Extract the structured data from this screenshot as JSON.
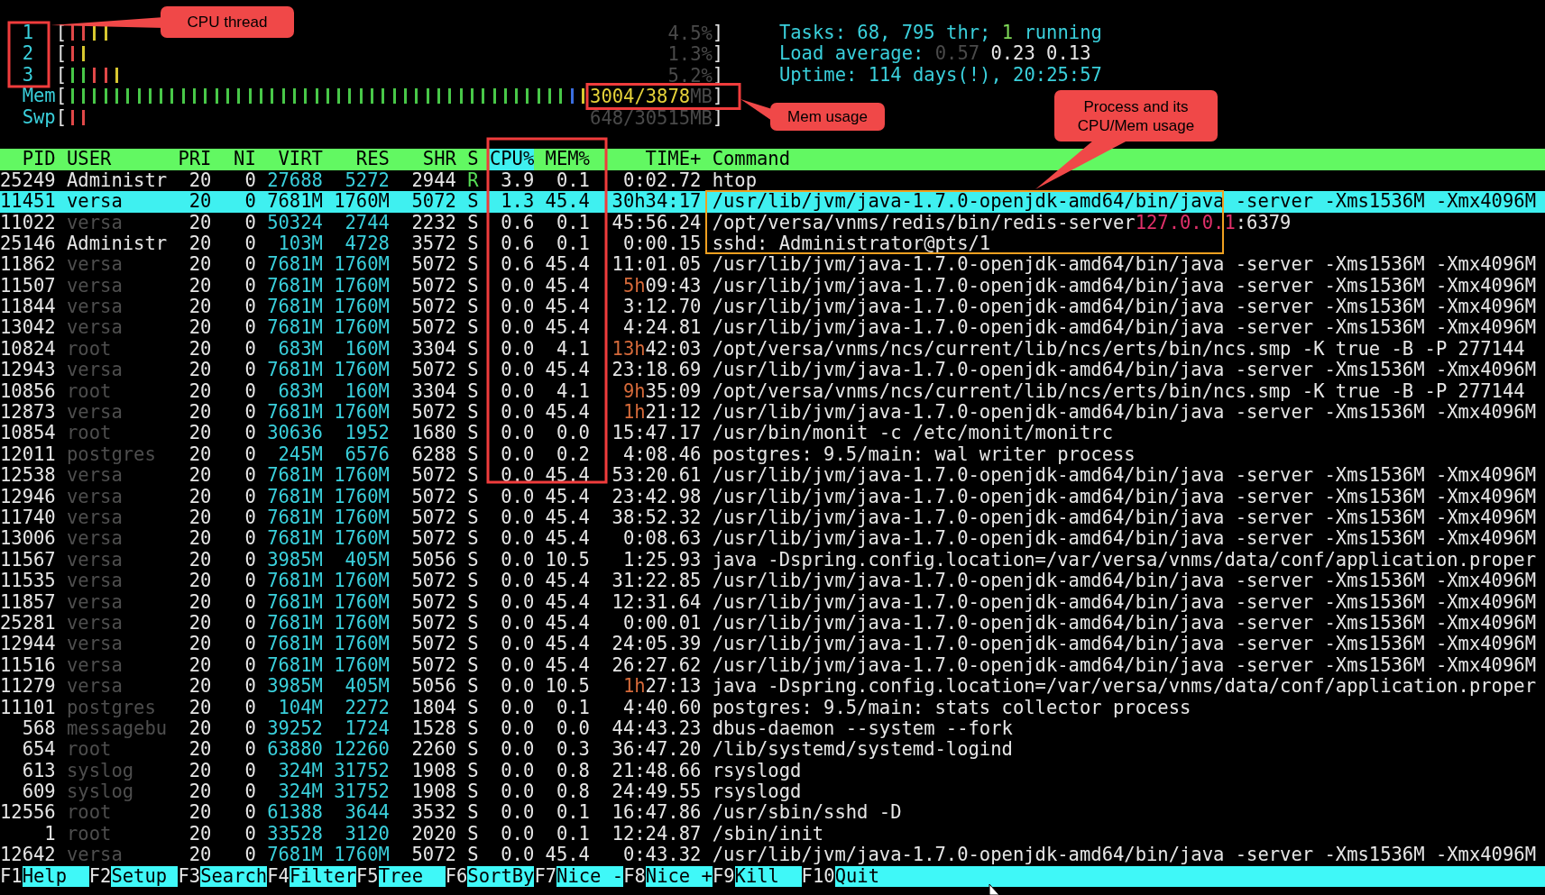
{
  "meters": [
    {
      "kind": "cpu",
      "label": "1",
      "open": "[",
      "close": "]",
      "value": "4.5%",
      "bars": [
        {
          "color": "#e04848"
        },
        {
          "color": "#e04848"
        },
        {
          "color": "#d8c830"
        },
        {
          "color": "#d8c830"
        }
      ]
    },
    {
      "kind": "cpu",
      "label": "2",
      "open": "[",
      "close": "]",
      "value": "1.3%",
      "bars": [
        {
          "color": "#e04848"
        },
        {
          "color": "#d8c830"
        }
      ]
    },
    {
      "kind": "cpu",
      "label": "3",
      "open": "[",
      "close": "]",
      "value": "5.2%",
      "bars": [
        {
          "color": "#48c848"
        },
        {
          "color": "#48c848"
        },
        {
          "color": "#e04848"
        },
        {
          "color": "#e04848"
        },
        {
          "color": "#d8c830"
        }
      ]
    },
    {
      "kind": "mem",
      "label": "Mem",
      "open": "[",
      "close": "]",
      "value": "3004/3878",
      "unit": "MB",
      "bars": [
        {
          "color": "#48c848"
        },
        {
          "color": "#48c848"
        },
        {
          "color": "#48c848"
        },
        {
          "color": "#48c848"
        },
        {
          "color": "#48c848"
        },
        {
          "color": "#48c848"
        },
        {
          "color": "#48c848"
        },
        {
          "color": "#48c848"
        },
        {
          "color": "#48c848"
        },
        {
          "color": "#48c848"
        },
        {
          "color": "#48c848"
        },
        {
          "color": "#48c848"
        },
        {
          "color": "#48c848"
        },
        {
          "color": "#48c848"
        },
        {
          "color": "#48c848"
        },
        {
          "color": "#48c848"
        },
        {
          "color": "#48c848"
        },
        {
          "color": "#48c848"
        },
        {
          "color": "#48c848"
        },
        {
          "color": "#48c848"
        },
        {
          "color": "#48c848"
        },
        {
          "color": "#48c848"
        },
        {
          "color": "#48c848"
        },
        {
          "color": "#48c848"
        },
        {
          "color": "#48c848"
        },
        {
          "color": "#48c848"
        },
        {
          "color": "#48c848"
        },
        {
          "color": "#48c848"
        },
        {
          "color": "#48c848"
        },
        {
          "color": "#48c848"
        },
        {
          "color": "#48c848"
        },
        {
          "color": "#48c848"
        },
        {
          "color": "#48c848"
        },
        {
          "color": "#48c848"
        },
        {
          "color": "#48c848"
        },
        {
          "color": "#48c848"
        },
        {
          "color": "#48c848"
        },
        {
          "color": "#48c848"
        },
        {
          "color": "#48c848"
        },
        {
          "color": "#48c848"
        },
        {
          "color": "#48c848"
        },
        {
          "color": "#48c848"
        },
        {
          "color": "#48c848"
        },
        {
          "color": "#48c848"
        },
        {
          "color": "#48c848"
        },
        {
          "color": "#3a6ee0"
        },
        {
          "color": "#d8c830"
        }
      ]
    },
    {
      "kind": "swap",
      "label": "Swp",
      "open": "[",
      "close": "]",
      "value": "648/30515",
      "unit": "MB",
      "bars": [
        {
          "color": "#e04848"
        },
        {
          "color": "#e04848"
        }
      ]
    }
  ],
  "summary": [
    {
      "parts": [
        {
          "text": "Tasks:",
          "kind": "label"
        },
        {
          "text": "68, 795 thr;",
          "kind": "value"
        },
        {
          "text": "1",
          "kind": "running"
        },
        {
          "text": "running",
          "kind": "label"
        }
      ]
    },
    {
      "parts": [
        {
          "text": "Load average:",
          "kind": "label"
        },
        {
          "text": "0.57",
          "kind": "dim"
        },
        {
          "text": "0.23 0.13",
          "kind": "highlight"
        }
      ]
    },
    {
      "parts": [
        {
          "text": "Uptime:",
          "kind": "label"
        },
        {
          "text": "114 days(!), 20:25:57",
          "kind": "value"
        }
      ]
    }
  ],
  "columns": [
    {
      "label": "PID",
      "selected": false
    },
    {
      "label": "USER",
      "selected": false
    },
    {
      "label": "PRI",
      "selected": false
    },
    {
      "label": "NI",
      "selected": false
    },
    {
      "label": "VIRT",
      "selected": false
    },
    {
      "label": "RES",
      "selected": false
    },
    {
      "label": "SHR",
      "selected": false
    },
    {
      "label": "S",
      "selected": false
    },
    {
      "label": "CPU%",
      "selected": true
    },
    {
      "label": "MEM%",
      "selected": false
    },
    {
      "label": "TIME+",
      "selected": false
    },
    {
      "label": "Command",
      "selected": false
    }
  ],
  "processes": [
    {
      "pid": "25249",
      "user": "Administr",
      "user_dimmed": false,
      "pri": "20",
      "ni": "0",
      "virt": "27688",
      "res": "5272",
      "shr": "2944",
      "s": "R",
      "running": true,
      "cpu": "3.9",
      "mem": "0.1",
      "time": "0:02.72",
      "command": "htop",
      "selected": false
    },
    {
      "pid": "11451",
      "user": "versa",
      "user_dimmed": false,
      "pri": "20",
      "ni": "0",
      "virt": "7681M",
      "res": "1760M",
      "shr": "5072",
      "s": "S",
      "running": false,
      "cpu": "1.3",
      "mem": "45.4",
      "hours": "30h",
      "time": "34:17",
      "command": "/usr/lib/jvm/java-1.7.0-openjdk-amd64/bin/java -server -Xms1536M -Xmx4096M",
      "selected": true
    },
    {
      "pid": "11022",
      "user": "versa",
      "user_dimmed": true,
      "pri": "20",
      "ni": "0",
      "virt": "50324",
      "res": "2744",
      "shr": "2232",
      "s": "S",
      "running": false,
      "cpu": "0.6",
      "mem": "0.1",
      "time": "45:56.24",
      "command": "/opt/versa/vnms/redis/bin/redis-server",
      "address": "127.0.0.1",
      "address_tail": ":6379",
      "selected": false
    },
    {
      "pid": "25146",
      "user": "Administr",
      "user_dimmed": false,
      "pri": "20",
      "ni": "0",
      "virt": "103M",
      "res": "4728",
      "shr": "3572",
      "s": "S",
      "running": false,
      "cpu": "0.6",
      "mem": "0.1",
      "time": "0:00.15",
      "command": "sshd: Administrator@pts/1",
      "selected": false
    },
    {
      "pid": "11862",
      "user": "versa",
      "user_dimmed": true,
      "pri": "20",
      "ni": "0",
      "virt": "7681M",
      "res": "1760M",
      "shr": "5072",
      "s": "S",
      "running": false,
      "cpu": "0.6",
      "mem": "45.4",
      "time": "11:01.05",
      "command": "/usr/lib/jvm/java-1.7.0-openjdk-amd64/bin/java -server -Xms1536M -Xmx4096M",
      "selected": false
    },
    {
      "pid": "11507",
      "user": "versa",
      "user_dimmed": true,
      "pri": "20",
      "ni": "0",
      "virt": "7681M",
      "res": "1760M",
      "shr": "5072",
      "s": "S",
      "running": false,
      "cpu": "0.0",
      "mem": "45.4",
      "hours": "5h",
      "time": "09:43",
      "command": "/usr/lib/jvm/java-1.7.0-openjdk-amd64/bin/java -server -Xms1536M -Xmx4096M",
      "selected": false
    },
    {
      "pid": "11844",
      "user": "versa",
      "user_dimmed": true,
      "pri": "20",
      "ni": "0",
      "virt": "7681M",
      "res": "1760M",
      "shr": "5072",
      "s": "S",
      "running": false,
      "cpu": "0.0",
      "mem": "45.4",
      "time": "3:12.70",
      "command": "/usr/lib/jvm/java-1.7.0-openjdk-amd64/bin/java -server -Xms1536M -Xmx4096M",
      "selected": false
    },
    {
      "pid": "13042",
      "user": "versa",
      "user_dimmed": true,
      "pri": "20",
      "ni": "0",
      "virt": "7681M",
      "res": "1760M",
      "shr": "5072",
      "s": "S",
      "running": false,
      "cpu": "0.0",
      "mem": "45.4",
      "time": "4:24.81",
      "command": "/usr/lib/jvm/java-1.7.0-openjdk-amd64/bin/java -server -Xms1536M -Xmx4096M",
      "selected": false
    },
    {
      "pid": "10824",
      "user": "root",
      "user_dimmed": true,
      "pri": "20",
      "ni": "0",
      "virt": "683M",
      "res": "160M",
      "shr": "3304",
      "s": "S",
      "running": false,
      "cpu": "0.0",
      "mem": "4.1",
      "hours": "13h",
      "time": "42:03",
      "command": "/opt/versa/vnms/ncs/current/lib/ncs/erts/bin/ncs.smp -K true -B -P 277144",
      "selected": false
    },
    {
      "pid": "12943",
      "user": "versa",
      "user_dimmed": true,
      "pri": "20",
      "ni": "0",
      "virt": "7681M",
      "res": "1760M",
      "shr": "5072",
      "s": "S",
      "running": false,
      "cpu": "0.0",
      "mem": "45.4",
      "time": "23:18.69",
      "command": "/usr/lib/jvm/java-1.7.0-openjdk-amd64/bin/java -server -Xms1536M -Xmx4096M",
      "selected": false
    },
    {
      "pid": "10856",
      "user": "root",
      "user_dimmed": true,
      "pri": "20",
      "ni": "0",
      "virt": "683M",
      "res": "160M",
      "shr": "3304",
      "s": "S",
      "running": false,
      "cpu": "0.0",
      "mem": "4.1",
      "hours": "9h",
      "time": "35:09",
      "command": "/opt/versa/vnms/ncs/current/lib/ncs/erts/bin/ncs.smp -K true -B -P 277144",
      "selected": false
    },
    {
      "pid": "12873",
      "user": "versa",
      "user_dimmed": true,
      "pri": "20",
      "ni": "0",
      "virt": "7681M",
      "res": "1760M",
      "shr": "5072",
      "s": "S",
      "running": false,
      "cpu": "0.0",
      "mem": "45.4",
      "hours": "1h",
      "time": "21:12",
      "command": "/usr/lib/jvm/java-1.7.0-openjdk-amd64/bin/java -server -Xms1536M -Xmx4096M",
      "selected": false
    },
    {
      "pid": "10854",
      "user": "root",
      "user_dimmed": true,
      "pri": "20",
      "ni": "0",
      "virt": "30636",
      "res": "1952",
      "shr": "1680",
      "s": "S",
      "running": false,
      "cpu": "0.0",
      "mem": "0.0",
      "time": "15:47.17",
      "command": "/usr/bin/monit -c /etc/monit/monitrc",
      "selected": false
    },
    {
      "pid": "12011",
      "user": "postgres",
      "user_dimmed": true,
      "pri": "20",
      "ni": "0",
      "virt": "245M",
      "res": "6576",
      "shr": "6288",
      "s": "S",
      "running": false,
      "cpu": "0.0",
      "mem": "0.2",
      "time": "4:08.46",
      "command": "postgres: 9.5/main: wal writer process",
      "selected": false
    },
    {
      "pid": "12538",
      "user": "versa",
      "user_dimmed": true,
      "pri": "20",
      "ni": "0",
      "virt": "7681M",
      "res": "1760M",
      "shr": "5072",
      "s": "S",
      "running": false,
      "cpu": "0.0",
      "mem": "45.4",
      "time": "53:20.61",
      "command": "/usr/lib/jvm/java-1.7.0-openjdk-amd64/bin/java -server -Xms1536M -Xmx4096M",
      "selected": false
    },
    {
      "pid": "12946",
      "user": "versa",
      "user_dimmed": true,
      "pri": "20",
      "ni": "0",
      "virt": "7681M",
      "res": "1760M",
      "shr": "5072",
      "s": "S",
      "running": false,
      "cpu": "0.0",
      "mem": "45.4",
      "time": "23:42.98",
      "command": "/usr/lib/jvm/java-1.7.0-openjdk-amd64/bin/java -server -Xms1536M -Xmx4096M",
      "selected": false
    },
    {
      "pid": "11740",
      "user": "versa",
      "user_dimmed": true,
      "pri": "20",
      "ni": "0",
      "virt": "7681M",
      "res": "1760M",
      "shr": "5072",
      "s": "S",
      "running": false,
      "cpu": "0.0",
      "mem": "45.4",
      "time": "38:52.32",
      "command": "/usr/lib/jvm/java-1.7.0-openjdk-amd64/bin/java -server -Xms1536M -Xmx4096M",
      "selected": false
    },
    {
      "pid": "13006",
      "user": "versa",
      "user_dimmed": true,
      "pri": "20",
      "ni": "0",
      "virt": "7681M",
      "res": "1760M",
      "shr": "5072",
      "s": "S",
      "running": false,
      "cpu": "0.0",
      "mem": "45.4",
      "time": "0:08.63",
      "command": "/usr/lib/jvm/java-1.7.0-openjdk-amd64/bin/java -server -Xms1536M -Xmx4096M",
      "selected": false
    },
    {
      "pid": "11567",
      "user": "versa",
      "user_dimmed": true,
      "pri": "20",
      "ni": "0",
      "virt": "3985M",
      "res": "405M",
      "shr": "5056",
      "s": "S",
      "running": false,
      "cpu": "0.0",
      "mem": "10.5",
      "time": "1:25.93",
      "command": "java -Dspring.config.location=/var/versa/vnms/data/conf/application.proper",
      "selected": false
    },
    {
      "pid": "11535",
      "user": "versa",
      "user_dimmed": true,
      "pri": "20",
      "ni": "0",
      "virt": "7681M",
      "res": "1760M",
      "shr": "5072",
      "s": "S",
      "running": false,
      "cpu": "0.0",
      "mem": "45.4",
      "time": "31:22.85",
      "command": "/usr/lib/jvm/java-1.7.0-openjdk-amd64/bin/java -server -Xms1536M -Xmx4096M",
      "selected": false
    },
    {
      "pid": "11857",
      "user": "versa",
      "user_dimmed": true,
      "pri": "20",
      "ni": "0",
      "virt": "7681M",
      "res": "1760M",
      "shr": "5072",
      "s": "S",
      "running": false,
      "cpu": "0.0",
      "mem": "45.4",
      "time": "12:31.64",
      "command": "/usr/lib/jvm/java-1.7.0-openjdk-amd64/bin/java -server -Xms1536M -Xmx4096M",
      "selected": false
    },
    {
      "pid": "25281",
      "user": "versa",
      "user_dimmed": true,
      "pri": "20",
      "ni": "0",
      "virt": "7681M",
      "res": "1760M",
      "shr": "5072",
      "s": "S",
      "running": false,
      "cpu": "0.0",
      "mem": "45.4",
      "time": "0:00.01",
      "command": "/usr/lib/jvm/java-1.7.0-openjdk-amd64/bin/java -server -Xms1536M -Xmx4096M",
      "selected": false
    },
    {
      "pid": "12944",
      "user": "versa",
      "user_dimmed": true,
      "pri": "20",
      "ni": "0",
      "virt": "7681M",
      "res": "1760M",
      "shr": "5072",
      "s": "S",
      "running": false,
      "cpu": "0.0",
      "mem": "45.4",
      "time": "24:05.39",
      "command": "/usr/lib/jvm/java-1.7.0-openjdk-amd64/bin/java -server -Xms1536M -Xmx4096M",
      "selected": false
    },
    {
      "pid": "11516",
      "user": "versa",
      "user_dimmed": true,
      "pri": "20",
      "ni": "0",
      "virt": "7681M",
      "res": "1760M",
      "shr": "5072",
      "s": "S",
      "running": false,
      "cpu": "0.0",
      "mem": "45.4",
      "time": "26:27.62",
      "command": "/usr/lib/jvm/java-1.7.0-openjdk-amd64/bin/java -server -Xms1536M -Xmx4096M",
      "selected": false
    },
    {
      "pid": "11279",
      "user": "versa",
      "user_dimmed": true,
      "pri": "20",
      "ni": "0",
      "virt": "3985M",
      "res": "405M",
      "shr": "5056",
      "s": "S",
      "running": false,
      "cpu": "0.0",
      "mem": "10.5",
      "hours": "1h",
      "time": "27:13",
      "command": "java -Dspring.config.location=/var/versa/vnms/data/conf/application.proper",
      "selected": false
    },
    {
      "pid": "11101",
      "user": "postgres",
      "user_dimmed": true,
      "pri": "20",
      "ni": "0",
      "virt": "104M",
      "res": "2272",
      "shr": "1804",
      "s": "S",
      "running": false,
      "cpu": "0.0",
      "mem": "0.1",
      "time": "4:40.60",
      "command": "postgres: 9.5/main: stats collector process",
      "selected": false
    },
    {
      "pid": "568",
      "user": "messagebu",
      "user_dimmed": true,
      "pri": "20",
      "ni": "0",
      "virt": "39252",
      "res": "1724",
      "shr": "1528",
      "s": "S",
      "running": false,
      "cpu": "0.0",
      "mem": "0.0",
      "time": "44:43.23",
      "command": "dbus-daemon --system --fork",
      "selected": false
    },
    {
      "pid": "654",
      "user": "root",
      "user_dimmed": true,
      "pri": "20",
      "ni": "0",
      "virt": "63880",
      "res": "12260",
      "shr": "2260",
      "s": "S",
      "running": false,
      "cpu": "0.0",
      "mem": "0.3",
      "time": "36:47.20",
      "command": "/lib/systemd/systemd-logind",
      "selected": false
    },
    {
      "pid": "613",
      "user": "syslog",
      "user_dimmed": true,
      "pri": "20",
      "ni": "0",
      "virt": "324M",
      "res": "31752",
      "shr": "1908",
      "s": "S",
      "running": false,
      "cpu": "0.0",
      "mem": "0.8",
      "time": "21:48.66",
      "command": "rsyslogd",
      "selected": false
    },
    {
      "pid": "609",
      "user": "syslog",
      "user_dimmed": true,
      "pri": "20",
      "ni": "0",
      "virt": "324M",
      "res": "31752",
      "shr": "1908",
      "s": "S",
      "running": false,
      "cpu": "0.0",
      "mem": "0.8",
      "time": "24:49.55",
      "command": "rsyslogd",
      "selected": false
    },
    {
      "pid": "12556",
      "user": "root",
      "user_dimmed": true,
      "pri": "20",
      "ni": "0",
      "virt": "61388",
      "res": "3644",
      "shr": "3532",
      "s": "S",
      "running": false,
      "cpu": "0.0",
      "mem": "0.1",
      "time": "16:47.86",
      "command": "/usr/sbin/sshd -D",
      "selected": false
    },
    {
      "pid": "1",
      "user": "root",
      "user_dimmed": true,
      "pri": "20",
      "ni": "0",
      "virt": "33528",
      "res": "3120",
      "shr": "2020",
      "s": "S",
      "running": false,
      "cpu": "0.0",
      "mem": "0.1",
      "time": "12:24.87",
      "command": "/sbin/init",
      "selected": false
    },
    {
      "pid": "12642",
      "user": "versa",
      "user_dimmed": true,
      "pri": "20",
      "ni": "0",
      "virt": "7681M",
      "res": "1760M",
      "shr": "5072",
      "s": "S",
      "running": false,
      "cpu": "0.0",
      "mem": "45.4",
      "time": "0:43.32",
      "command": "/usr/lib/jvm/java-1.7.0-openjdk-amd64/bin/java -server -Xms1536M -Xmx4096M",
      "selected": false
    }
  ],
  "function_keys": [
    {
      "key": "F1",
      "label": "Help"
    },
    {
      "key": "F2",
      "label": "Setup"
    },
    {
      "key": "F3",
      "label": "Search"
    },
    {
      "key": "F4",
      "label": "Filter"
    },
    {
      "key": "F5",
      "label": "Tree"
    },
    {
      "key": "F6",
      "label": "SortBy"
    },
    {
      "key": "F7",
      "label": "Nice -"
    },
    {
      "key": "F8",
      "label": "Nice +"
    },
    {
      "key": "F9",
      "label": "Kill"
    },
    {
      "key": "F10",
      "label": "Quit"
    }
  ],
  "annotations": [
    {
      "text": "CPU thread"
    },
    {
      "text": "Mem usage"
    },
    {
      "text": "Process and its CPU/Mem usage"
    }
  ]
}
